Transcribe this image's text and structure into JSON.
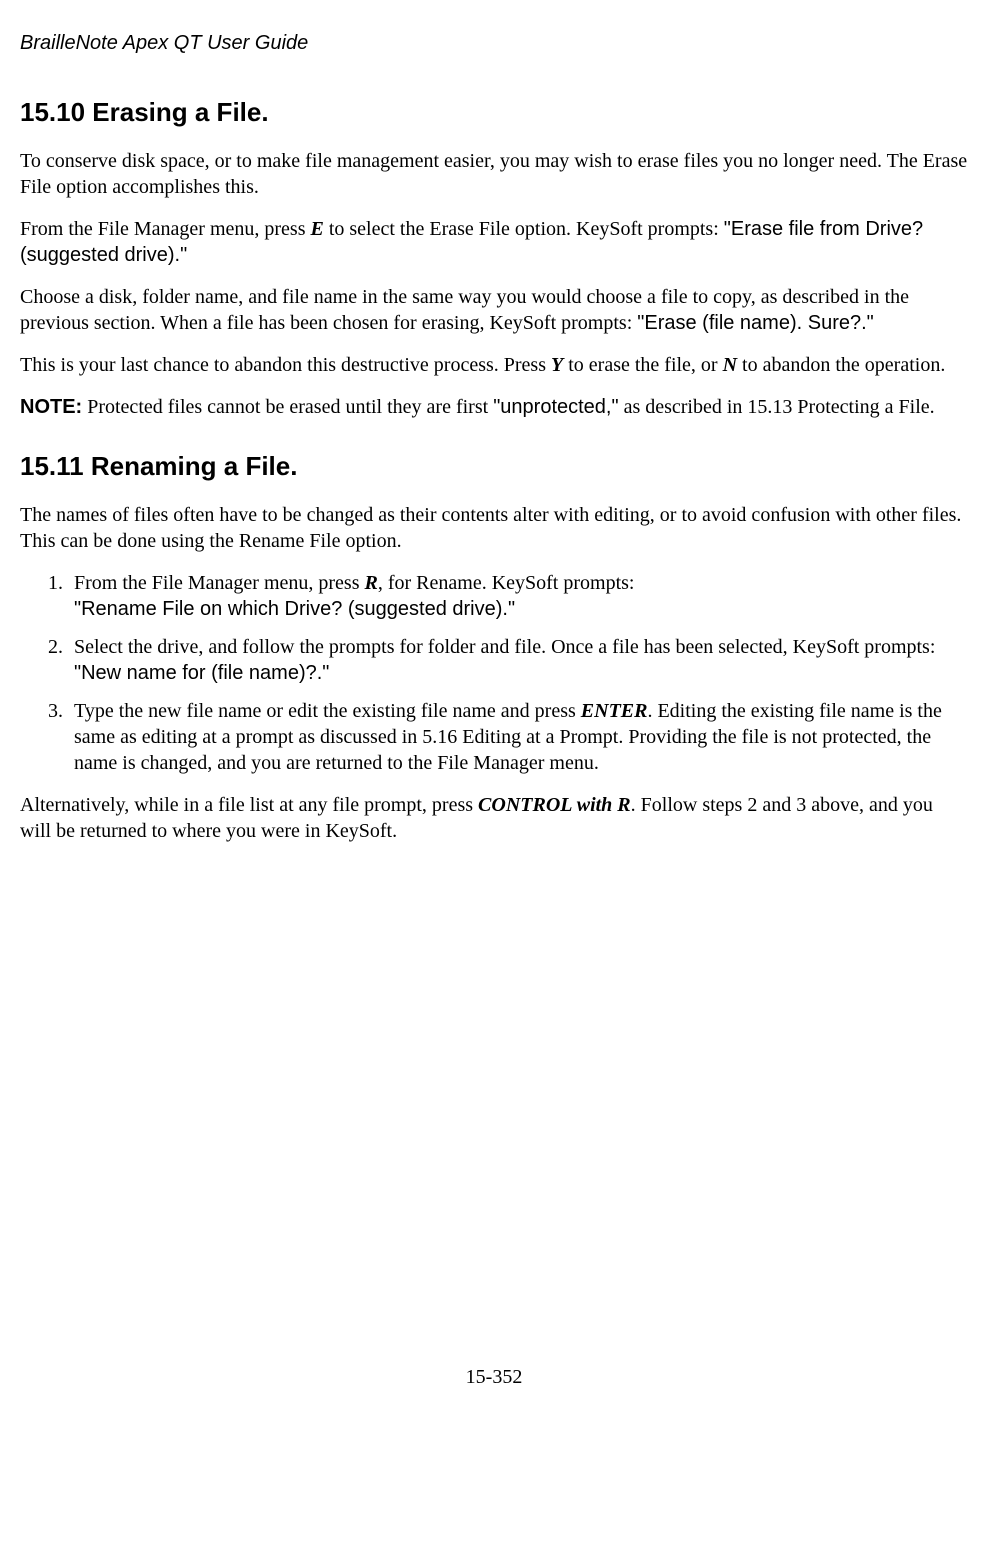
{
  "header": "BrailleNote Apex QT User Guide",
  "section1": {
    "heading": "15.10   Erasing a File.",
    "p1": "To conserve disk space, or to make file management easier, you may wish to erase files you no longer need. The Erase File option accomplishes this.",
    "p2a": "From the File Manager menu, press ",
    "p2key": "E",
    "p2b": " to select the Erase File option. KeySoft prompts: ",
    "p2prompt": "\"Erase file from Drive? (suggested drive).\"",
    "p3a": "Choose a disk, folder name, and file name in the same way you would choose a file to copy, as described in the previous section. When a file has been chosen for erasing, KeySoft prompts: ",
    "p3prompt": "\"Erase (file name). Sure?.\"",
    "p4a": "This is your last chance to abandon this destructive process. Press ",
    "p4key1": "Y",
    "p4b": " to erase the file, or ",
    "p4key2": "N",
    "p4c": " to abandon the operation.",
    "noteLabel": "NOTE:",
    "note1": " Protected files cannot be erased until they are first ",
    "notePrompt": "\"unprotected,\"",
    "note2": " as described in 15.13 Protecting a File."
  },
  "section2": {
    "heading": "15.11   Renaming a File.",
    "p1": "The names of files often have to be changed as their contents alter with editing, or to avoid confusion with other files. This can be done using the Rename File option.",
    "li1a": "From the File Manager menu, press ",
    "li1key": "R",
    "li1b": ", for Rename. KeySoft prompts: ",
    "li1prompt": "\"Rename File on which Drive? (suggested drive).\"",
    "li2a": "Select the drive, and follow the prompts for folder and file. Once a file has been selected, KeySoft prompts: ",
    "li2prompt": "\"New name for (file name)?.\"",
    "li3a": "Type the new file name or edit the existing file name and press ",
    "li3key": "ENTER",
    "li3b": ". Editing the existing file name is the same as editing at a prompt as discussed in 5.16 Editing at a Prompt. Providing the file is not protected, the name is changed, and you are returned to the File Manager menu.",
    "alt1": "Alternatively, while in a file list at any file prompt, press ",
    "altkey": "CONTROL with R",
    "alt2": ". Follow steps 2 and 3 above, and you will be returned to where you were in KeySoft."
  },
  "footer": "15-352"
}
